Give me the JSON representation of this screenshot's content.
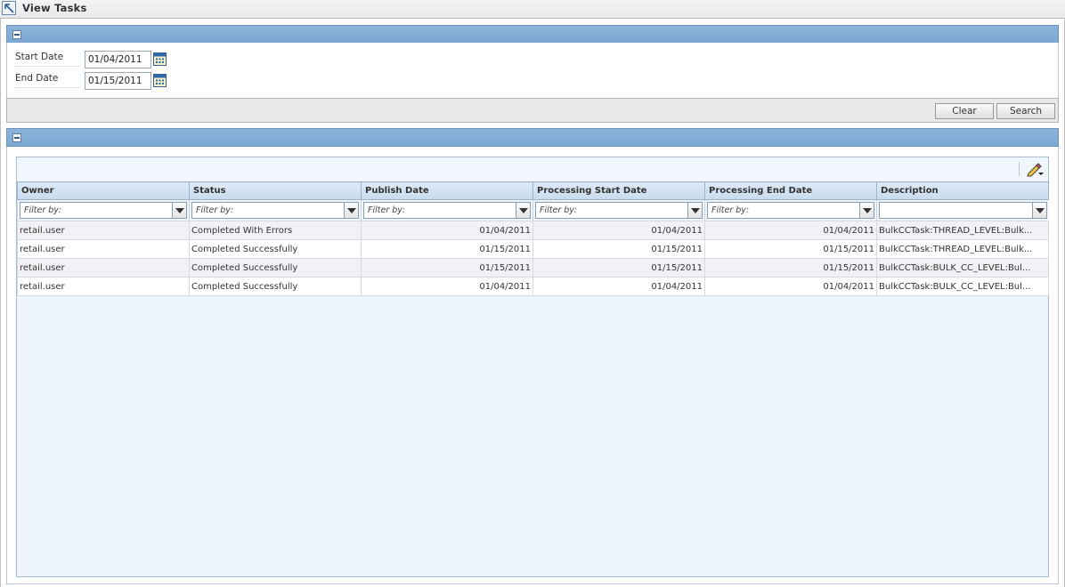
{
  "window": {
    "title": "View Tasks"
  },
  "search": {
    "start_label": "Start Date",
    "start_value": "01/04/2011",
    "end_label": "End Date",
    "end_value": "01/15/2011",
    "clear_label": "Clear",
    "search_label": "Search"
  },
  "table": {
    "columns": [
      "Owner",
      "Status",
      "Publish Date",
      "Processing Start Date",
      "Processing End Date",
      "Description"
    ],
    "filter_placeholder": "Filter by:",
    "filters": [
      "Filter by:",
      "Filter by:",
      "Filter by:",
      "Filter by:",
      "Filter by:",
      ""
    ],
    "rows": [
      [
        "retail.user",
        "Completed With Errors",
        "01/04/2011",
        "01/04/2011",
        "01/04/2011",
        "BulkCCTask:THREAD_LEVEL:Bulk..."
      ],
      [
        "retail.user",
        "Completed Successfully",
        "01/15/2011",
        "01/15/2011",
        "01/15/2011",
        "BulkCCTask:THREAD_LEVEL:Bulk..."
      ],
      [
        "retail.user",
        "Completed Successfully",
        "01/15/2011",
        "01/15/2011",
        "01/15/2011",
        "BulkCCTask:BULK_CC_LEVEL:Bul..."
      ],
      [
        "retail.user",
        "Completed Successfully",
        "01/04/2011",
        "01/04/2011",
        "01/04/2011",
        "BulkCCTask:BULK_CC_LEVEL:Bul..."
      ]
    ]
  },
  "icons": {
    "title": "resize-arrow-icon",
    "calendar": "calendar-icon",
    "collapse": "collapse-icon",
    "edit": "pencil-edit-icon",
    "dropdown": "chevron-down-icon"
  },
  "colors": {
    "panel_header": "#7ba7d2",
    "table_bg": "#eef5fc",
    "header_bg": "#c8dbee"
  }
}
